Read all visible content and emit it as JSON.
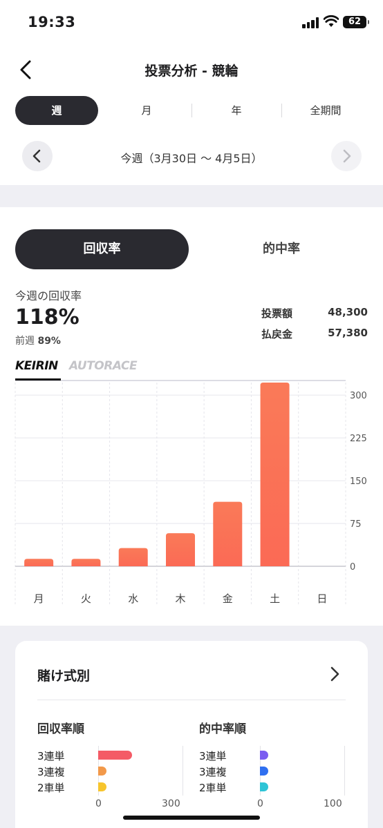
{
  "status": {
    "time": "19:33",
    "battery": "62"
  },
  "header": {
    "title": "投票分析 - 競輪",
    "period_tabs": [
      "週",
      "月",
      "年",
      "全期間"
    ],
    "active_tab": "週",
    "week_label": "今週（3月30日 〜 4月5日）"
  },
  "metric_toggle": {
    "active": "回収率",
    "inactive": "的中率"
  },
  "summary": {
    "label": "今週の回収率",
    "value": "118%",
    "prev_label": "前週",
    "prev_value": "89%",
    "bet_label": "投票額",
    "bet_value": "48,300",
    "payout_label": "払戻金",
    "payout_value": "57,380"
  },
  "brand_tabs": {
    "active": "KEIRIN",
    "inactive": "AUTORACE"
  },
  "chart_data": {
    "type": "bar",
    "categories": [
      "月",
      "火",
      "水",
      "木",
      "金",
      "土",
      "日"
    ],
    "values": [
      13,
      13,
      32,
      58,
      113,
      322,
      0
    ],
    "yticks": [
      0,
      75,
      150,
      225,
      300
    ],
    "ylim": [
      0,
      322
    ],
    "grid": true,
    "bar_color": "#fb6a55"
  },
  "bet_types": {
    "title": "賭け式別",
    "left": {
      "title": "回収率順",
      "rows": [
        {
          "label": "3連単",
          "value": 120,
          "color": "#f45b66"
        },
        {
          "label": "3連複",
          "value": 30,
          "color": "#f2994a"
        },
        {
          "label": "2車単",
          "value": 30,
          "color": "#f7c52d"
        }
      ],
      "axis_min": "0",
      "axis_max": "300",
      "max": 300
    },
    "right": {
      "title": "的中率順",
      "rows": [
        {
          "label": "3連単",
          "value": 10,
          "color": "#7a5cf0"
        },
        {
          "label": "3連複",
          "value": 10,
          "color": "#2f6ff0"
        },
        {
          "label": "2車単",
          "value": 10,
          "color": "#2ec4d6"
        }
      ],
      "axis_min": "0",
      "axis_max": "100",
      "max": 100
    }
  }
}
